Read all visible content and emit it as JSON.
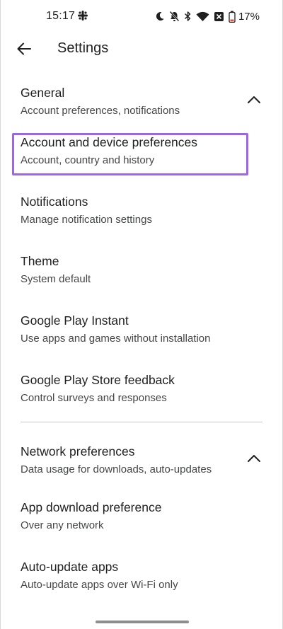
{
  "status_bar": {
    "time": "15:17",
    "battery": "17%"
  },
  "app_bar": {
    "title": "Settings"
  },
  "sections": [
    {
      "title": "General",
      "subtitle": "Account preferences, notifications",
      "items": [
        {
          "title": "Account and device preferences",
          "subtitle": "Account, country and history"
        },
        {
          "title": "Notifications",
          "subtitle": "Manage notification settings"
        },
        {
          "title": "Theme",
          "subtitle": "System default"
        },
        {
          "title": "Google Play Instant",
          "subtitle": "Use apps and games without installation"
        },
        {
          "title": "Google Play Store feedback",
          "subtitle": "Control surveys and responses"
        }
      ]
    },
    {
      "title": "Network preferences",
      "subtitle": "Data usage for downloads, auto-updates",
      "items": [
        {
          "title": "App download preference",
          "subtitle": "Over any network"
        },
        {
          "title": "Auto-update apps",
          "subtitle": "Auto-update apps over Wi-Fi only"
        }
      ]
    }
  ],
  "colors": {
    "highlight": "#a064e6",
    "text_primary": "#1f1f1f",
    "text_secondary": "#444746"
  }
}
